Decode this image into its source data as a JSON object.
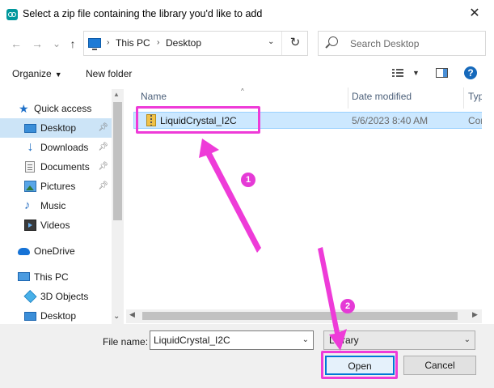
{
  "window": {
    "title": "Select a zip file containing the library you'd like to add",
    "close_glyph": "✕"
  },
  "nav_buttons": {
    "back": "←",
    "forward": "→",
    "recent": "⌄",
    "up": "↑"
  },
  "address": {
    "crumbs": [
      "This PC",
      "Desktop"
    ],
    "separator": "›",
    "dropdown_glyph": "⌄",
    "refresh_glyph": "↻"
  },
  "search": {
    "placeholder": "Search Desktop"
  },
  "toolbar": {
    "organize_label": "Organize",
    "new_folder_label": "New folder",
    "help_glyph": "?"
  },
  "nav_pane": {
    "items": [
      {
        "label": "Quick access",
        "icon": "star-icon",
        "pinned": false,
        "selected": false
      },
      {
        "label": "Desktop",
        "icon": "desktop-icon",
        "pinned": true,
        "selected": true
      },
      {
        "label": "Downloads",
        "icon": "download-icon",
        "pinned": true,
        "selected": false
      },
      {
        "label": "Documents",
        "icon": "documents-icon",
        "pinned": true,
        "selected": false
      },
      {
        "label": "Pictures",
        "icon": "pictures-icon",
        "pinned": true,
        "selected": false
      },
      {
        "label": "Music",
        "icon": "music-icon",
        "pinned": false,
        "selected": false
      },
      {
        "label": "Videos",
        "icon": "videos-icon",
        "pinned": false,
        "selected": false
      },
      {
        "label": "OneDrive",
        "icon": "cloud-icon",
        "pinned": false,
        "selected": false
      },
      {
        "label": "This PC",
        "icon": "computer-icon",
        "pinned": false,
        "selected": false
      },
      {
        "label": "3D Objects",
        "icon": "3d-objects-icon",
        "pinned": false,
        "selected": false
      },
      {
        "label": "Desktop",
        "icon": "desktop-icon",
        "pinned": false,
        "selected": false
      }
    ]
  },
  "file_list": {
    "columns": [
      "Name",
      "Date modified",
      "Type"
    ],
    "rows": [
      {
        "name": "LiquidCrystal_I2C",
        "date_modified": "5/6/2023 8:40 AM",
        "type": "Com",
        "selected": true
      }
    ]
  },
  "bottom": {
    "file_name_label": "File name:",
    "file_name_value": "LiquidCrystal_I2C",
    "filter_value": "Library",
    "open_label": "Open",
    "cancel_label": "Cancel"
  },
  "annotations": {
    "color": "#ee3bd8",
    "badges": [
      "1",
      "2"
    ]
  },
  "colors": {
    "selection": "#cce8ff",
    "nav_selection": "#cce4f7",
    "accent": "#0078d7"
  }
}
